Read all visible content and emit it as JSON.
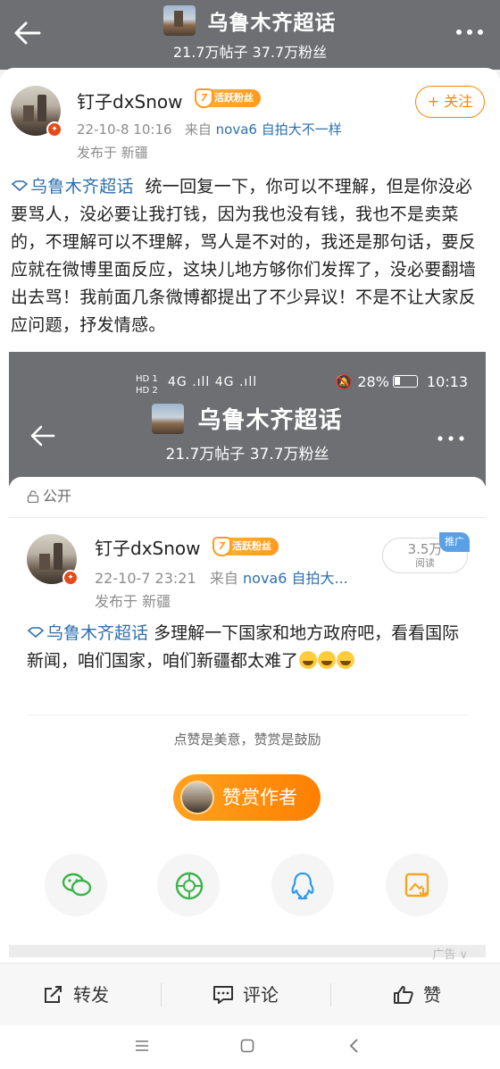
{
  "header": {
    "title": "乌鲁木齐超话",
    "stats": "21.7万帖子 37.7万粉丝"
  },
  "post": {
    "username": "钉子dxSnow",
    "fan_level": "7",
    "fan_badge": "活跃粉丝",
    "datetime": "22-10-8 10:16",
    "source_prefix": "来自",
    "source": "nova6 自拍大不一样",
    "location": "发布于 新疆",
    "follow_label": "+ 关注",
    "topic": "乌鲁木齐超话",
    "text": "统一回复一下，你可以不理解，但是你没必要骂人，没必要让我打钱，因为我也没有钱，我也不是卖菜的，不理解可以不理解，骂人是不对的，我还是那句话，要反应就在微博里面反应，这块儿地方够你们发挥了，没必要翻墙出去骂！我前面几条微博都提出了不少异议！不是不让大家反应问题，抒发情感。"
  },
  "embedded": {
    "statusbar": {
      "left_labels": [
        "HD 1",
        "HD 2"
      ],
      "signal": "4G .ıll 4G .ıll",
      "battery": "28%",
      "time": "10:13"
    },
    "header": {
      "title": "乌鲁木齐超话",
      "stats": "21.7万帖子 37.7万粉丝"
    },
    "visibility": "公开",
    "post": {
      "username": "钉子dxSnow",
      "fan_level": "7",
      "fan_badge": "活跃粉丝",
      "datetime": "22-10-7 23:21",
      "source_prefix": "来自",
      "source": "nova6 自拍大...",
      "location": "发布于 新疆",
      "reads_value": "3.5万",
      "reads_label": "阅读",
      "promo_badge": "推广",
      "topic": "乌鲁木齐超话",
      "text": "多理解一下国家和地方政府吧，看看国际新闻，咱们国家，咱们新疆都太难了"
    },
    "praise_text": "点赞是美意，赞赏是鼓励",
    "reward_label": "赞赏作者",
    "share_icons": [
      "wechat-icon",
      "moments-icon",
      "qq-icon",
      "save-image-icon"
    ]
  },
  "ad_label": "广告 ∨",
  "actions": {
    "repost": "转发",
    "comment": "评论",
    "like": "赞"
  },
  "nav": [
    "menu-icon",
    "home-icon",
    "back-icon"
  ],
  "colors": {
    "header_bg": "#6d6f72",
    "link": "#2d6fad",
    "accent": "#ff8200"
  }
}
